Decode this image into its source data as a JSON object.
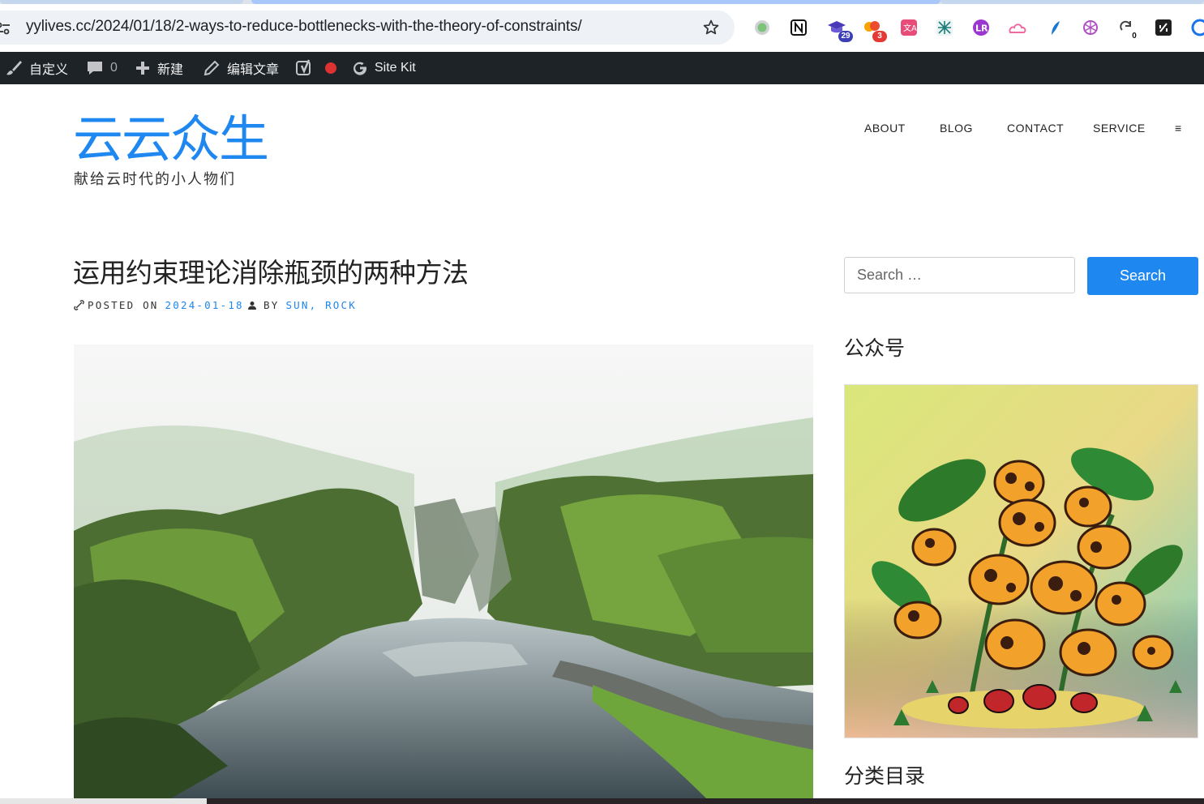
{
  "browser": {
    "url": "yylives.cc/2024/01/18/2-ways-to-reduce-bottlenecks-with-the-theory-of-constraints/",
    "extensions": [
      {
        "icon": "circle-status-icon",
        "badge": ""
      },
      {
        "icon": "notion-icon",
        "badge": ""
      },
      {
        "icon": "graduation-cap-icon",
        "badge": "29"
      },
      {
        "icon": "cloud-note-icon",
        "badge": "3"
      },
      {
        "icon": "translate-icon",
        "badge": ""
      },
      {
        "icon": "network-icon",
        "badge": ""
      },
      {
        "icon": "purple-logo-icon",
        "badge": ""
      },
      {
        "icon": "pink-cloud-icon",
        "badge": ""
      },
      {
        "icon": "feather-icon",
        "badge": ""
      },
      {
        "icon": "openai-icon",
        "badge": ""
      },
      {
        "icon": "redo-counter-icon",
        "badge": "0"
      },
      {
        "icon": "dark-square-icon",
        "badge": ""
      },
      {
        "icon": "blue-swirl-icon",
        "badge": ""
      }
    ]
  },
  "admin_bar": {
    "customize_label": "自定义",
    "comments_count": "0",
    "new_label": "新建",
    "edit_label": "编辑文章",
    "sitekit_label": "Site Kit"
  },
  "site": {
    "title": "云云众生",
    "tagline": "献给云时代的小人物们"
  },
  "nav": {
    "items": [
      "ABOUT",
      "BLOG",
      "CONTACT",
      "SERVICE"
    ],
    "menu_symbol": "≡"
  },
  "post": {
    "title": "运用约束理论消除瓶颈的两种方法",
    "posted_on_label": "POSTED ON",
    "date": "2024-01-18",
    "by_label": "BY",
    "author": "SUN, ROCK"
  },
  "sidebar": {
    "search_placeholder": "Search …",
    "search_button": "Search",
    "widget_wechat_title": "公众号",
    "widget_categories_title": "分类目录"
  },
  "colors": {
    "accent": "#1e87f0",
    "admin_bar": "#1d2327"
  }
}
